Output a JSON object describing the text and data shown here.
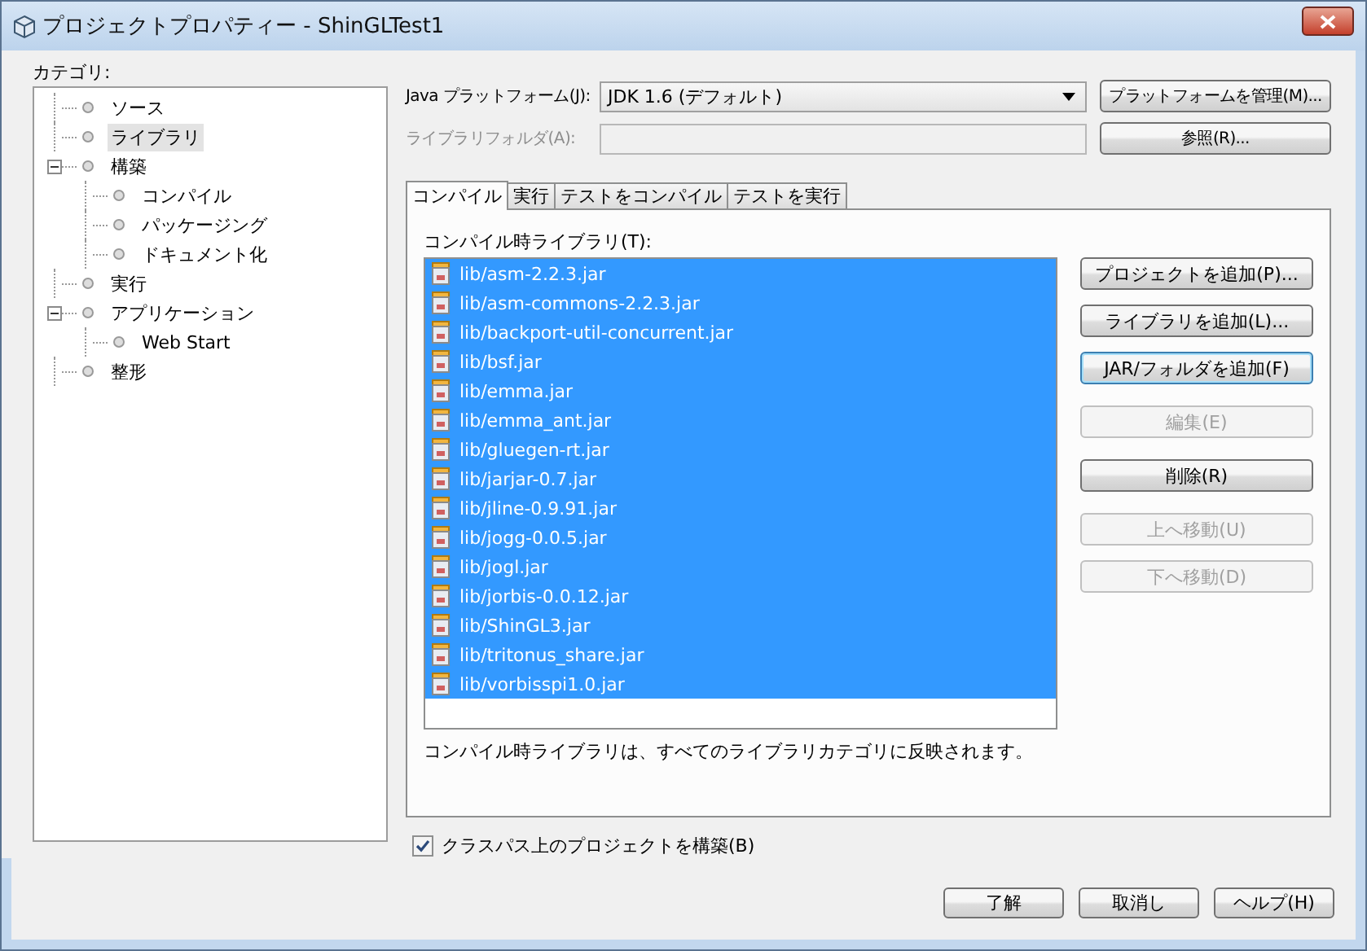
{
  "window": {
    "title": "プロジェクトプロパティー - ShinGLTest1"
  },
  "categories": {
    "label": "カテゴリ:",
    "items": [
      {
        "label": "ソース",
        "selected": false
      },
      {
        "label": "ライブラリ",
        "selected": true
      },
      {
        "label": "構築",
        "selected": false,
        "expanded": true,
        "children": [
          {
            "label": "コンパイル",
            "selected": false
          },
          {
            "label": "パッケージング",
            "selected": false
          },
          {
            "label": "ドキュメント化",
            "selected": false
          }
        ]
      },
      {
        "label": "実行",
        "selected": false
      },
      {
        "label": "アプリケーション",
        "selected": false,
        "expanded": true,
        "children": [
          {
            "label": "Web Start",
            "selected": false
          }
        ]
      },
      {
        "label": "整形",
        "selected": false
      }
    ]
  },
  "platform": {
    "label": "Java プラットフォーム(J):",
    "value": "JDK 1.6 (デフォルト)",
    "button": "プラットフォームを管理(M)..."
  },
  "library_folder": {
    "label": "ライブラリフォルダ(A):",
    "disabled": true,
    "button": "参照(R)..."
  },
  "tabs": [
    {
      "label": "コンパイル",
      "selected": true
    },
    {
      "label": "実行",
      "selected": false
    },
    {
      "label": "テストをコンパイル",
      "selected": false
    },
    {
      "label": "テストを実行",
      "selected": false
    }
  ],
  "libraries": {
    "label": "コンパイル時ライブラリ(T):",
    "items": [
      {
        "name": "lib/asm-2.2.3.jar",
        "selected": true
      },
      {
        "name": "lib/asm-commons-2.2.3.jar",
        "selected": true
      },
      {
        "name": "lib/backport-util-concurrent.jar",
        "selected": true
      },
      {
        "name": "lib/bsf.jar",
        "selected": true
      },
      {
        "name": "lib/emma.jar",
        "selected": true
      },
      {
        "name": "lib/emma_ant.jar",
        "selected": true
      },
      {
        "name": "lib/gluegen-rt.jar",
        "selected": true
      },
      {
        "name": "lib/jarjar-0.7.jar",
        "selected": true
      },
      {
        "name": "lib/jline-0.9.91.jar",
        "selected": true
      },
      {
        "name": "lib/jogg-0.0.5.jar",
        "selected": true
      },
      {
        "name": "lib/jogl.jar",
        "selected": true
      },
      {
        "name": "lib/jorbis-0.0.12.jar",
        "selected": true
      },
      {
        "name": "lib/ShinGL3.jar",
        "selected": true
      },
      {
        "name": "lib/tritonus_share.jar",
        "selected": true
      },
      {
        "name": "lib/vorbisspi1.0.jar",
        "selected": true
      }
    ],
    "buttons": [
      {
        "label": "プロジェクトを追加(P)...",
        "disabled": false,
        "focused": false
      },
      {
        "label": "ライブラリを追加(L)...",
        "disabled": false,
        "focused": false
      },
      {
        "label": "JAR/フォルダを追加(F)",
        "disabled": false,
        "focused": true
      },
      {
        "label": "編集(E)",
        "disabled": true,
        "focused": false
      },
      {
        "label": "削除(R)",
        "disabled": false,
        "focused": false
      },
      {
        "label": "上へ移動(U)",
        "disabled": true,
        "focused": false
      },
      {
        "label": "下へ移動(D)",
        "disabled": true,
        "focused": false
      }
    ],
    "note": "コンパイル時ライブラリは、すべてのライブラリカテゴリに反映されます。"
  },
  "build_on_classpath": {
    "label": "クラスパス上のプロジェクトを構築(B)",
    "checked": true
  },
  "dialog_buttons": [
    "了解",
    "取消し",
    "ヘルプ(H)"
  ]
}
